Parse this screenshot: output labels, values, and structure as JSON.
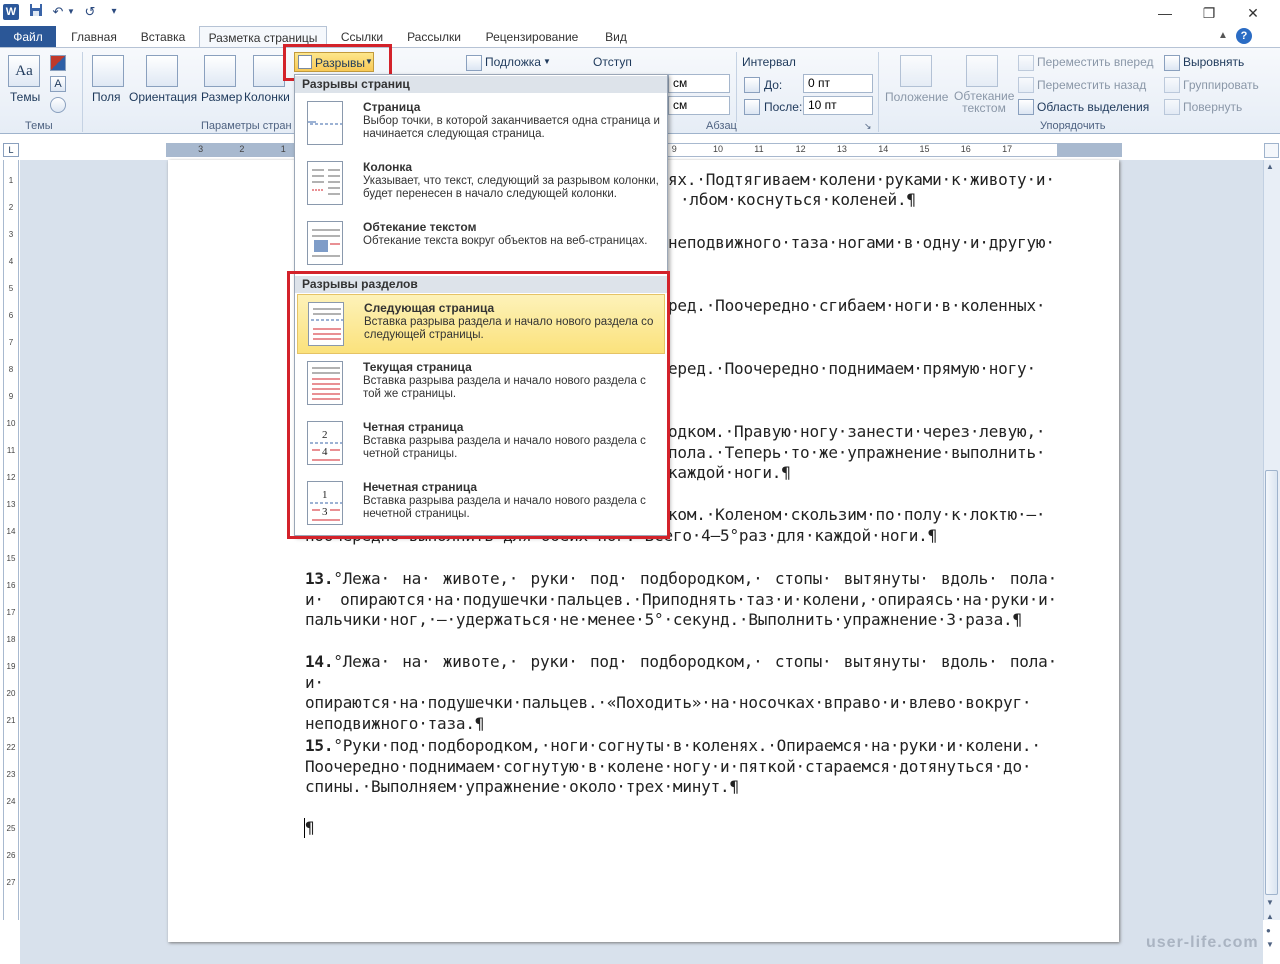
{
  "titlebar": {
    "app_icon": "W",
    "undo": "↶",
    "redo": "↺"
  },
  "tabs": {
    "file": "Файл",
    "items": [
      "Главная",
      "Вставка",
      "Разметка страницы",
      "Ссылки",
      "Рассылки",
      "Рецензирование",
      "Вид"
    ],
    "active_index": 2
  },
  "ribbon": {
    "themes": {
      "label": "Темы",
      "group": "Темы"
    },
    "page_setup": {
      "fields": "Поля",
      "orientation": "Ориентация",
      "size": "Размер",
      "columns": "Колонки",
      "breaks": "Разрывы",
      "group": "Параметры стран"
    },
    "background": {
      "watermark": "Подложка"
    },
    "paragraph": {
      "indent": "Отступ",
      "interval": "Интервал",
      "left_unit": "см",
      "right_unit": "см",
      "before_label": "До:",
      "before_value": "0 пт",
      "after_label": "После:",
      "after_value": "10 пт",
      "group": "Абзац"
    },
    "arrange": {
      "position": "Положение",
      "wrap": "Обтекание текстом",
      "bring_forward": "Переместить вперед",
      "send_backward": "Переместить назад",
      "selection_pane": "Область выделения",
      "align": "Выровнять",
      "group_btn": "Группировать",
      "rotate": "Повернуть",
      "group": "Упорядочить"
    }
  },
  "breaks_menu": {
    "page_breaks_header": "Разрывы страниц",
    "page_breaks": [
      {
        "title": "Страница",
        "desc": "Выбор точки, в которой заканчивается одна страница и начинается следующая страница.",
        "icon": "page-break-icon"
      },
      {
        "title": "Колонка",
        "desc": "Указывает, что текст, следующий за разрывом колонки, будет перенесен в начало следующей колонки.",
        "icon": "column-break-icon"
      },
      {
        "title": "Обтекание текстом",
        "desc": "Обтекание текста вокруг объектов на веб-страницах.",
        "icon": "text-wrapping-icon"
      }
    ],
    "section_breaks_header": "Разрывы разделов",
    "section_breaks": [
      {
        "title": "Следующая страница",
        "desc": "Вставка разрыва раздела и начало нового раздела со следующей страницы.",
        "icon": "next-page-icon"
      },
      {
        "title": "Текущая страница",
        "desc": "Вставка разрыва раздела и начало нового раздела с той же страницы.",
        "icon": "continuous-icon"
      },
      {
        "title": "Четная страница",
        "desc": "Вставка разрыва раздела и начало нового раздела с четной страницы.",
        "icon": "even-page-icon",
        "nums": [
          "2",
          "4"
        ]
      },
      {
        "title": "Нечетная страница",
        "desc": "Вставка разрыва раздела и начало нового раздела с нечетной страницы.",
        "icon": "odd-page-icon",
        "nums": [
          "1",
          "3"
        ]
      }
    ]
  },
  "ruler": {
    "h_ticks": [
      "3",
      "2",
      "1",
      "1",
      "2",
      "3",
      "4",
      "5",
      "6",
      "7",
      "8",
      "9",
      "10",
      "11",
      "12",
      "13",
      "14",
      "15",
      "16",
      "17"
    ],
    "v_ticks": [
      "1",
      "2",
      "3",
      "4",
      "5",
      "6",
      "7",
      "8",
      "9",
      "10",
      "11",
      "12",
      "13",
      "14",
      "15",
      "16",
      "17",
      "18",
      "19",
      "20",
      "21",
      "22",
      "23",
      "24",
      "25",
      "26",
      "27"
    ]
  },
  "document": {
    "partial_lines": [
      "ях.·Подтягиваем·колени·руками·к·животу·и·",
      "·лбом·коснуться·коленей.¶",
      "неподвижного·таза·ногами·в·одну·и·другую·",
      "ред.·Поочередно·сгибаем·ноги·в·коленных·",
      "еред.·Поочередно·поднимаем·прямую·ногу·",
      "одком.·Правую·ногу·занести·через·левую,·",
      "пола.·Теперь·то·же·упражнение·выполнить·",
      "каждой·ноги.¶",
      "ком.·Коленом·скользим·по·полу·к·локтю·–·",
      "поочередно·выполнить·для·обеих·ног.·Всего·4–5°раз·для·каждой·ноги.¶"
    ],
    "paragraphs": [
      {
        "num": "13.",
        "text": "°Лежа· на· животе,· руки· под· подбородком,· стопы· вытянуты· вдоль· пола· и· опираются·на·подушечки·пальцев.·Приподнять·таз·и·колени,·опираясь·на·руки·и· пальчики·ног,·–·удержаться·не·менее·5°·секунд.·Выполнить·упражнение·3·раза.¶"
      },
      {
        "num": "14.",
        "text": "°Лежа· на· животе,· руки· под· подбородком,· стопы· вытянуты· вдоль· пола· и· опираются·на·подушечки·пальцев.·«Походить»·на·носочках·вправо·и·влево·вокруг· неподвижного·таза.¶"
      },
      {
        "num": "15.",
        "text": "°Руки·под·подбородком,·ноги·согнуты·в·коленях.·Опираемся·на·руки·и·колени.· Поочередно·поднимаем·согнутую·в·колене·ногу·и·пяткой·стараемся·дотянуться·до· спины.·Выполняем·упражнение·около·трех·минут.¶"
      }
    ],
    "end_mark": "¶"
  },
  "watermark": "user-life.com"
}
